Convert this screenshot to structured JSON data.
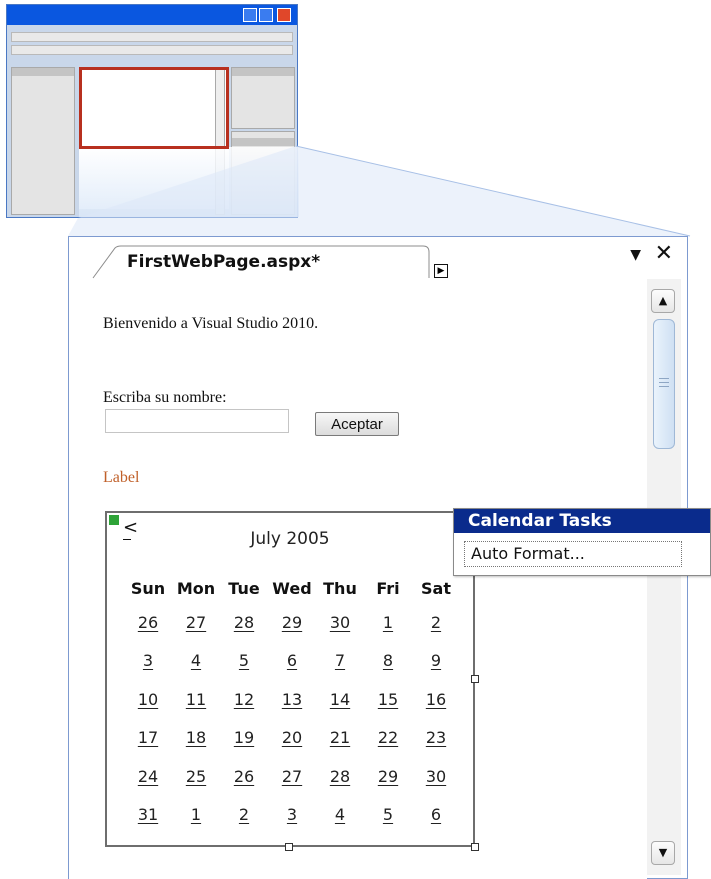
{
  "document": {
    "tab_title": "FirstWebPage.aspx*",
    "close_glyph": "✕",
    "menu_glyph": "▼"
  },
  "page": {
    "welcome_text": "Bienvenido a Visual Studio 2010.",
    "name_prompt": "Escriba su nombre:",
    "name_value": "",
    "accept_label": "Aceptar",
    "label_text": "Label"
  },
  "calendar": {
    "prev_nav": "<",
    "next_nav": ">",
    "title": "July 2005",
    "days_of_week": [
      "Sun",
      "Mon",
      "Tue",
      "Wed",
      "Thu",
      "Fri",
      "Sat"
    ],
    "weeks": [
      [
        "26",
        "27",
        "28",
        "29",
        "30",
        "1",
        "2"
      ],
      [
        "3",
        "4",
        "5",
        "6",
        "7",
        "8",
        "9"
      ],
      [
        "10",
        "11",
        "12",
        "13",
        "14",
        "15",
        "16"
      ],
      [
        "17",
        "18",
        "19",
        "20",
        "21",
        "22",
        "23"
      ],
      [
        "24",
        "25",
        "26",
        "27",
        "28",
        "29",
        "30"
      ],
      [
        "31",
        "1",
        "2",
        "3",
        "4",
        "5",
        "6"
      ]
    ]
  },
  "smart_tag": {
    "title": "Calendar Tasks",
    "items": [
      "Auto Format..."
    ]
  },
  "scrollbar": {
    "up_glyph": "▲",
    "down_glyph": "▼"
  },
  "colors": {
    "tasks_header_bg": "#0a2b8c",
    "label_color": "#c0602a",
    "selection_frame": "#b8301f",
    "mini_titlebar": "#0a57e0"
  }
}
